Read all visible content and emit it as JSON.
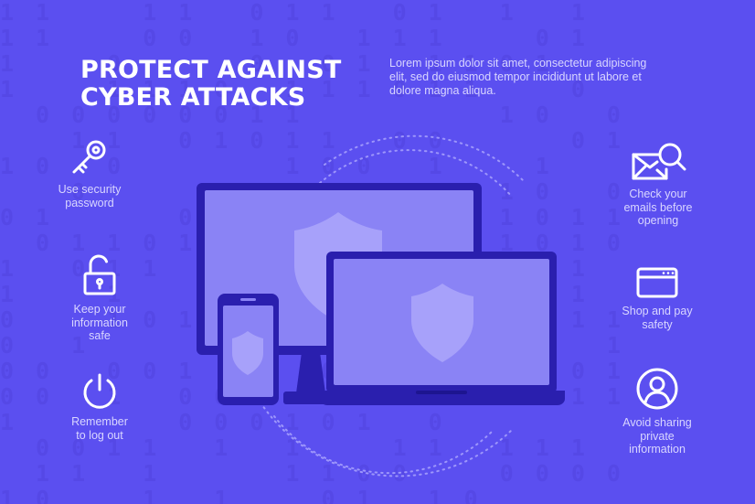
{
  "header": {
    "title_line1": "PROTECT AGAINST",
    "title_line2": "CYBER ATTACKS",
    "intro_line1": "Lorem ipsum dolor sit amet, consectetur adipiscing",
    "intro_line2": "elit, sed do eiusmod tempor incididunt ut labore et",
    "intro_line3": "dolore magna aliqua."
  },
  "left_tips": [
    {
      "icon": "key-icon",
      "line1": "Use security",
      "line2": "password"
    },
    {
      "icon": "unlocked-padlock-icon",
      "line1": "Keep your",
      "line2": "information",
      "line3": "safe"
    },
    {
      "icon": "power-icon",
      "line1": "Remember",
      "line2": "to log out"
    }
  ],
  "right_tips": [
    {
      "icon": "email-search-icon",
      "line1": "Check your",
      "line2": "emails before",
      "line3": "opening"
    },
    {
      "icon": "browser-window-icon",
      "line1": "Shop and pay",
      "line2": "safety"
    },
    {
      "icon": "user-profile-icon",
      "line1": "Avoid sharing",
      "line2": "private",
      "line3": "information"
    }
  ],
  "colors": {
    "background": "#5b4ff0",
    "binary_digits": "#5548e6",
    "device_frame": "#2a1fae",
    "screen": "#8a83f5",
    "shield": "#a7a1fa"
  }
}
